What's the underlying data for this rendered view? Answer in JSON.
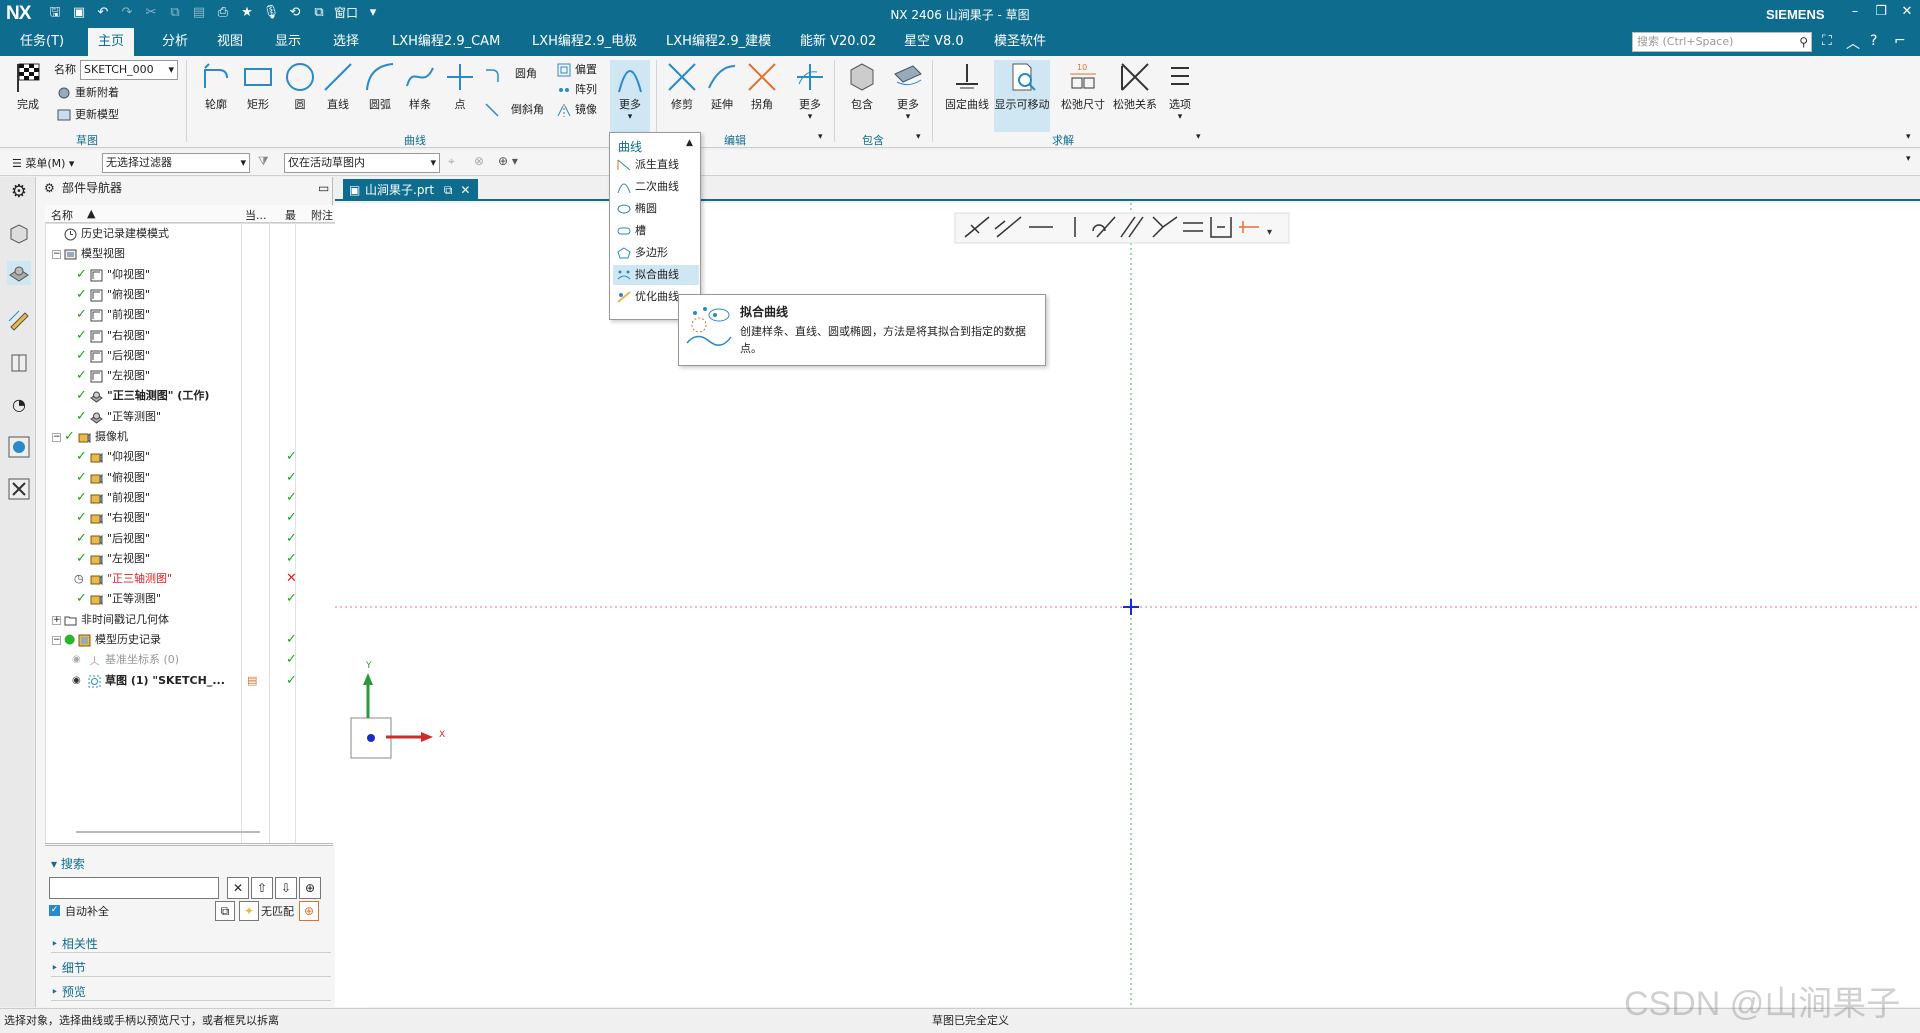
{
  "window": {
    "logo": "NX",
    "title": "NX 2406 山涧果子 - 草图",
    "brand": "SIEMENS",
    "window_menu": "窗口"
  },
  "menu_tabs": [
    "任务(T)",
    "主页",
    "分析",
    "视图",
    "显示",
    "选择",
    "LXH编程2.9_CAM",
    "LXH编程2.9_电极",
    "LXH编程2.9_建模",
    "能新 V20.02",
    "星空 V8.0",
    "模圣软件"
  ],
  "active_tab": "主页",
  "search": {
    "placeholder": "搜索 (Ctrl+Space)"
  },
  "ribbon": {
    "finish_label": "完成",
    "name_label": "名称",
    "sketch_name": "SKETCH_000",
    "reattach": "重新附着",
    "update_model": "更新模型",
    "group_sketch": "草图",
    "curve_buttons": [
      "轮廓",
      "矩形",
      "圆",
      "直线",
      "圆弧",
      "样条",
      "点"
    ],
    "fillet": "圆角",
    "chamfer": "倒斜角",
    "offset": "偏置",
    "pattern": "阵列",
    "mirror": "镜像",
    "more": "更多",
    "group_curve": "曲线",
    "edit_buttons": [
      "修剪",
      "延伸",
      "拐角",
      "更多"
    ],
    "group_edit": "编辑",
    "include_buttons": [
      "包含",
      "更多"
    ],
    "group_include": "包含",
    "solve_buttons": [
      "固定曲线",
      "显示可移动",
      "松弛尺寸",
      "松弛关系",
      "选项"
    ],
    "group_solve": "求解"
  },
  "selection_bar": {
    "menu": "菜单(M)",
    "filter": "无选择过滤器",
    "scope": "仅在活动草图内"
  },
  "navigator": {
    "title": "部件导航器",
    "col_name": "名称",
    "col_current": "当...",
    "col_latest": "最",
    "col_note": "附注",
    "rows": [
      {
        "text": "历史记录建模模式",
        "level": 0
      },
      {
        "text": "模型视图",
        "level": 0
      },
      {
        "text": "\"仰视图\"",
        "level": 1
      },
      {
        "text": "\"俯视图\"",
        "level": 1
      },
      {
        "text": "\"前视图\"",
        "level": 1
      },
      {
        "text": "\"右视图\"",
        "level": 1
      },
      {
        "text": "\"后视图\"",
        "level": 1
      },
      {
        "text": "\"左视图\"",
        "level": 1
      },
      {
        "text": "\"正三轴测图\" (工作)",
        "level": 1
      },
      {
        "text": "\"正等测图\"",
        "level": 1
      },
      {
        "text": "摄像机",
        "level": 0
      },
      {
        "text": "\"仰视图\"",
        "level": 1
      },
      {
        "text": "\"俯视图\"",
        "level": 1
      },
      {
        "text": "\"前视图\"",
        "level": 1
      },
      {
        "text": "\"右视图\"",
        "level": 1
      },
      {
        "text": "\"后视图\"",
        "level": 1
      },
      {
        "text": "\"左视图\"",
        "level": 1
      },
      {
        "text": "\"正三轴测图\"",
        "level": 1
      },
      {
        "text": "\"正等测图\"",
        "level": 1
      },
      {
        "text": "非时间戳记几何体",
        "level": 0
      },
      {
        "text": "模型历史记录",
        "level": 0
      },
      {
        "text": "基准坐标系 (0)",
        "level": 1
      },
      {
        "text": "草图 (1) \"SKETCH_...",
        "level": 1
      }
    ],
    "search_title": "搜索",
    "auto_complete": "自动补全",
    "no_match": "无匹配",
    "sections": [
      "相关性",
      "细节",
      "预览"
    ]
  },
  "document_tab": "山涧果子.prt",
  "dropdown": {
    "header": "曲线",
    "items": [
      "派生直线",
      "二次曲线",
      "椭圆",
      "槽",
      "多边形",
      "拟合曲线",
      "优化曲线"
    ],
    "highlighted": "拟合曲线"
  },
  "tooltip": {
    "title": "拟合曲线",
    "body": "创建样条、直线、圆或椭圆，方法是将其拟合到指定的数据点。"
  },
  "axes": {
    "x": "X",
    "y": "Y"
  },
  "status": {
    "left": "选择对象，选择曲线或手柄以预览尺寸，或者框旯以拆离",
    "center": "草图已完全定义"
  },
  "watermark": "CSDN @山涧果子",
  "colors": {
    "accent": "#0e6d8f",
    "ok": "#1aa51a",
    "error": "#e02020"
  }
}
